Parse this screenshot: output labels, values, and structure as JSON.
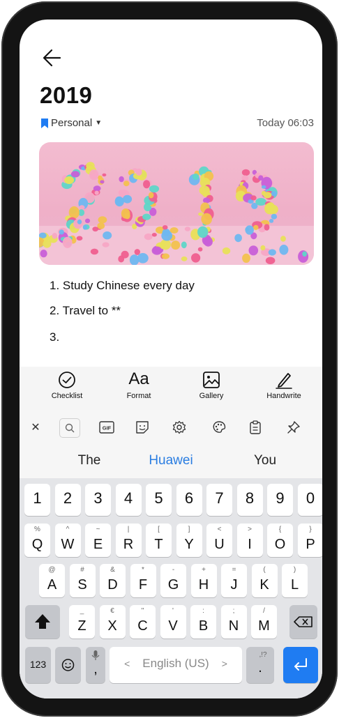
{
  "note": {
    "title": "2019",
    "folder": "Personal",
    "timestamp": "Today 06:03",
    "items": [
      "1. Study Chinese every day",
      "2. Travel to **",
      "3."
    ]
  },
  "toolbar": {
    "checklist": "Checklist",
    "format_glyph": "Aa",
    "format": "Format",
    "gallery": "Gallery",
    "handwrite": "Handwrite"
  },
  "keyboard": {
    "suggestions": [
      "The",
      "Huawei",
      "You"
    ],
    "number_row": [
      "1",
      "2",
      "3",
      "4",
      "5",
      "6",
      "7",
      "8",
      "9",
      "0"
    ],
    "row1": [
      {
        "main": "Q",
        "sub": "%"
      },
      {
        "main": "W",
        "sub": "^"
      },
      {
        "main": "E",
        "sub": "~"
      },
      {
        "main": "R",
        "sub": "|"
      },
      {
        "main": "T",
        "sub": "["
      },
      {
        "main": "Y",
        "sub": "]"
      },
      {
        "main": "U",
        "sub": "<"
      },
      {
        "main": "I",
        "sub": ">"
      },
      {
        "main": "O",
        "sub": "{"
      },
      {
        "main": "P",
        "sub": "}"
      }
    ],
    "row2": [
      {
        "main": "A",
        "sub": "@"
      },
      {
        "main": "S",
        "sub": "#"
      },
      {
        "main": "D",
        "sub": "&"
      },
      {
        "main": "F",
        "sub": "*"
      },
      {
        "main": "G",
        "sub": "-"
      },
      {
        "main": "H",
        "sub": "+"
      },
      {
        "main": "J",
        "sub": "="
      },
      {
        "main": "K",
        "sub": "("
      },
      {
        "main": "L",
        "sub": ")"
      }
    ],
    "row3": [
      {
        "main": "Z",
        "sub": "_"
      },
      {
        "main": "X",
        "sub": "€"
      },
      {
        "main": "C",
        "sub": "\""
      },
      {
        "main": "V",
        "sub": "'"
      },
      {
        "main": "B",
        "sub": ":"
      },
      {
        "main": "N",
        "sub": ";"
      },
      {
        "main": "M",
        "sub": "/"
      }
    ],
    "numbers_key": "123",
    "comma": ",",
    "space_label": "English (US)",
    "space_left": "<",
    "space_right": ">",
    "period_key": ".",
    "period_sub": ",!?"
  }
}
